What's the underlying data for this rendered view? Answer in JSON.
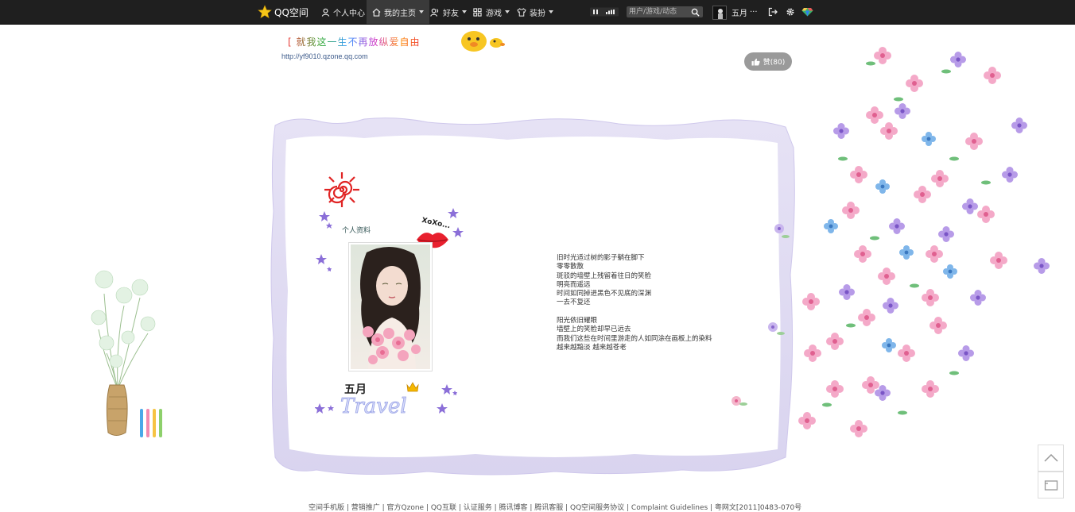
{
  "topbar": {
    "logo": "QQ空间",
    "nav": [
      {
        "label": "个人中心",
        "icon": "user-icon"
      },
      {
        "label": "我的主页",
        "icon": "home-icon",
        "active": true
      },
      {
        "label": "好友",
        "icon": "friends-icon"
      },
      {
        "label": "游戏",
        "icon": "grid-icon"
      },
      {
        "label": "装扮",
        "icon": "shirt-icon"
      }
    ],
    "search_placeholder": "用户/游戏/动态",
    "username": "五月",
    "more": "···"
  },
  "header": {
    "title": "[ 就我这一生不再放纵爱自由",
    "url": "http://yf9010.qzone.qq.com",
    "like_label": "赞(80)"
  },
  "profile": {
    "section_label": "个人资料",
    "name": "五月",
    "decor_text": "Travel",
    "kiss_text": "XoXo..."
  },
  "poem": [
    "旧时光适过树的影子躺在脚下",
    "零零散散",
    "斑驳的墙壁上残留着往日的笑脸",
    "明亮而遥远",
    "时间如同掉进黑色不见底的深渊",
    "一去不复还",
    "",
    "阳光依旧耀眼",
    "墙壁上的笑脸却早已远去",
    "而我们这些在时间里游走的人如同涂在画板上的染料",
    "越来越黯淡 越来越苍老"
  ],
  "footer": "空间手机版 | 营销推广 | 官方Qzone | QQ互联 | 认证服务 | 腾讯博客 | 腾讯客服 | QQ空间服务协议 | Complaint Guidelines | 粤网文[2011]0483-070号",
  "colors": {
    "topbar": "#1f1f1f",
    "accent": "#f5c518",
    "like": "#9a9a9a"
  }
}
